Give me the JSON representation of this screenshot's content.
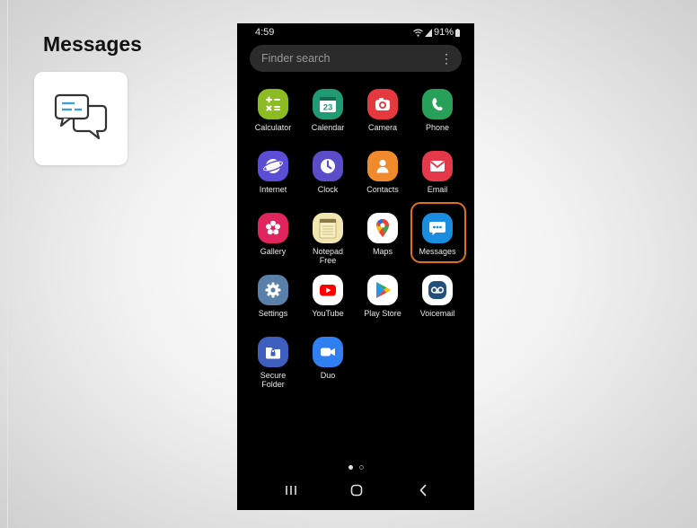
{
  "slide": {
    "title": "Messages",
    "topic_icon": "chat-bubbles-icon"
  },
  "status_bar": {
    "time": "4:59",
    "battery": "91%",
    "icons": [
      "wifi-icon",
      "signal-icon",
      "battery-icon"
    ]
  },
  "search": {
    "placeholder": "Finder search",
    "menu_icon": "more-vertical-icon"
  },
  "apps": [
    {
      "label": "Calculator",
      "icon": "calculator-icon",
      "color": "#8dbb24"
    },
    {
      "label": "Calendar",
      "icon": "calendar-icon",
      "color": "#1f9a72",
      "badge": "23"
    },
    {
      "label": "Camera",
      "icon": "camera-icon",
      "color": "#e5383f"
    },
    {
      "label": "Phone",
      "icon": "phone-icon",
      "color": "#28a05a"
    },
    {
      "label": "Internet",
      "icon": "internet-icon",
      "color": "#5a4ed6"
    },
    {
      "label": "Clock",
      "icon": "clock-icon",
      "color": "#5b4cc9"
    },
    {
      "label": "Contacts",
      "icon": "contacts-icon",
      "color": "#f08a2c"
    },
    {
      "label": "Email",
      "icon": "email-icon",
      "color": "#e5384a"
    },
    {
      "label": "Gallery",
      "icon": "gallery-icon",
      "color": "#e0245e"
    },
    {
      "label": "Notepad\nFree",
      "icon": "notepad-icon",
      "color": "#f1e6b0"
    },
    {
      "label": "Maps",
      "icon": "maps-icon",
      "color": "#ffffff"
    },
    {
      "label": "Messages",
      "icon": "messages-icon",
      "color": "#1a8de0"
    },
    {
      "label": "Settings",
      "icon": "settings-icon",
      "color": "#5a7fa8"
    },
    {
      "label": "YouTube",
      "icon": "youtube-icon",
      "color": "#ffffff"
    },
    {
      "label": "Play Store",
      "icon": "play-store-icon",
      "color": "#ffffff"
    },
    {
      "label": "Voicemail",
      "icon": "voicemail-icon",
      "color": "#ffffff"
    },
    {
      "label": "Secure\nFolder",
      "icon": "secure-folder-icon",
      "color": "#3f5fbf"
    },
    {
      "label": "Duo",
      "icon": "duo-icon",
      "color": "#2f7ff2"
    }
  ],
  "highlighted_app": "Messages",
  "highlight_color": "#e0701e",
  "pager": {
    "page": 1,
    "pages": 2
  },
  "navbar": {
    "icons": [
      "recent-apps-icon",
      "home-icon",
      "back-icon"
    ]
  }
}
